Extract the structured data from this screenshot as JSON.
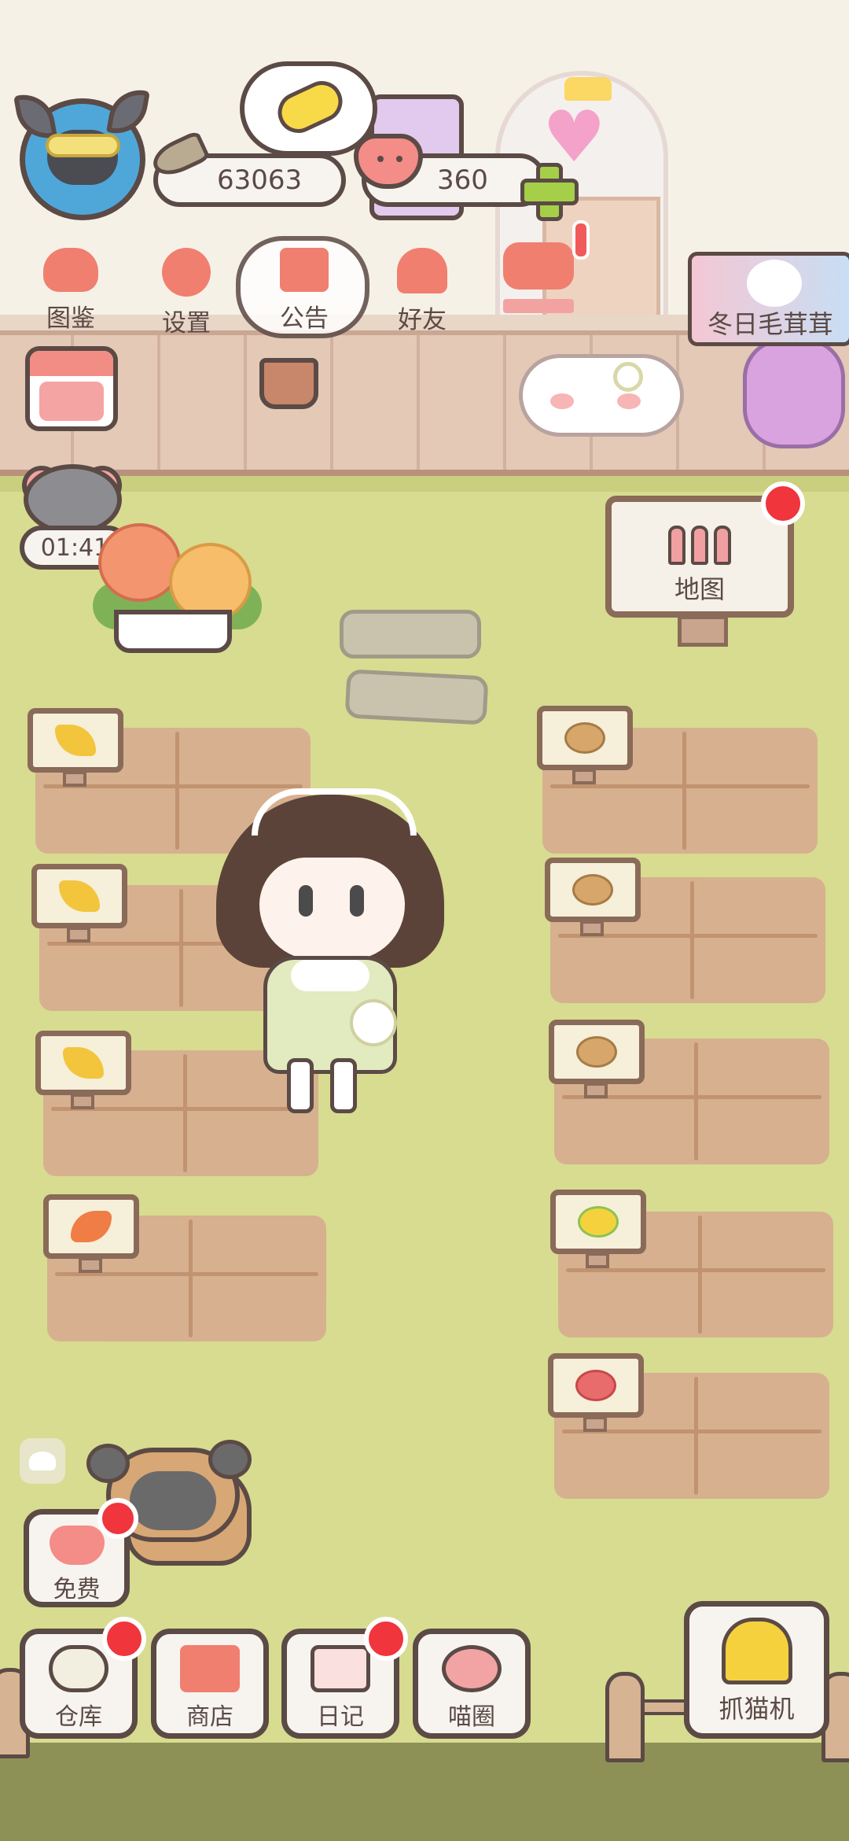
{
  "hud": {
    "coins": "63063",
    "hearts": "360",
    "timer": "01:41"
  },
  "menu": {
    "items": [
      {
        "label": "图鉴",
        "icon": "cat-book-icon"
      },
      {
        "label": "设置",
        "icon": "gear-icon"
      },
      {
        "label": "公告",
        "icon": "gift-icon"
      },
      {
        "label": "好友",
        "icon": "friends-icon"
      }
    ]
  },
  "banner": {
    "winter_event": "冬日毛茸茸"
  },
  "map_sign": {
    "label": "地图"
  },
  "fields": {
    "left": [
      {
        "crop": "wheat"
      },
      {
        "crop": "wheat"
      },
      {
        "crop": "wheat"
      },
      {
        "crop": "carrot"
      }
    ],
    "right": [
      {
        "crop": "potato"
      },
      {
        "crop": "potato"
      },
      {
        "crop": "potato"
      },
      {
        "crop": "corn"
      },
      {
        "crop": "tomato"
      }
    ]
  },
  "bottom": {
    "free": "免费",
    "warehouse": "仓库",
    "shop": "商店",
    "diary": "日记",
    "meow_circle": "喵圈",
    "claw_machine": "抓猫机"
  },
  "colors": {
    "ground": "#d7dc90",
    "soil": "#d7ae8f",
    "outline": "#5b4a45",
    "notify": "#f0353d",
    "accent": "#f07f70"
  }
}
